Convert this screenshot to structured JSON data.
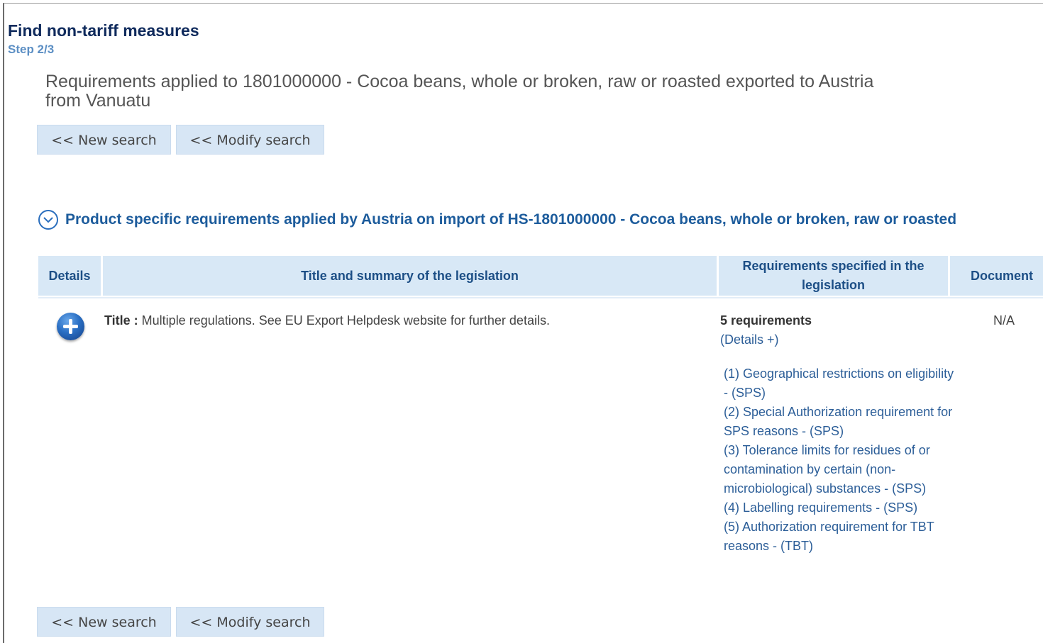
{
  "page": {
    "title": "Find non-tariff measures",
    "step": "Step 2/3",
    "heading": "Requirements applied to 1801000000 - Cocoa beans, whole or broken, raw or roasted exported to Austria from Vanuatu"
  },
  "buttons": {
    "new_search": "<< New search",
    "modify_search": "<< Modify search"
  },
  "section": {
    "title": "Product specific requirements applied by Austria on import of HS-1801000000 - Cocoa beans, whole or broken, raw or roasted",
    "icon": "chevron-down-circle-icon"
  },
  "table": {
    "headers": {
      "details": "Details",
      "title_summary": "Title and summary of the legislation",
      "requirements": "Requirements specified in the legislation",
      "document": "Document"
    },
    "row": {
      "title_label": "Title :",
      "title_text": " Multiple regulations. See EU Export Helpdesk website for further details.",
      "req_count": "5 requirements",
      "details_link": "(Details +)",
      "requirements": [
        "(1) Geographical restrictions on eligibility - (SPS)",
        "(2) Special Authorization requirement for SPS reasons - (SPS)",
        "(3) Tolerance limits for residues of or contamination by certain (non-microbiological) substances - (SPS)",
        "(4) Labelling requirements - (SPS)",
        "(5) Authorization requirement for TBT reasons - (TBT)"
      ],
      "document": "N/A",
      "expand_icon": "plus-circle-icon"
    }
  },
  "colors": {
    "title": "#0f2a5c",
    "step": "#5c8fc4",
    "section_title": "#1d5c9c",
    "header_bg": "#d8e8f6",
    "link": "#2c5e98",
    "button_bg": "#d7e6f5"
  }
}
